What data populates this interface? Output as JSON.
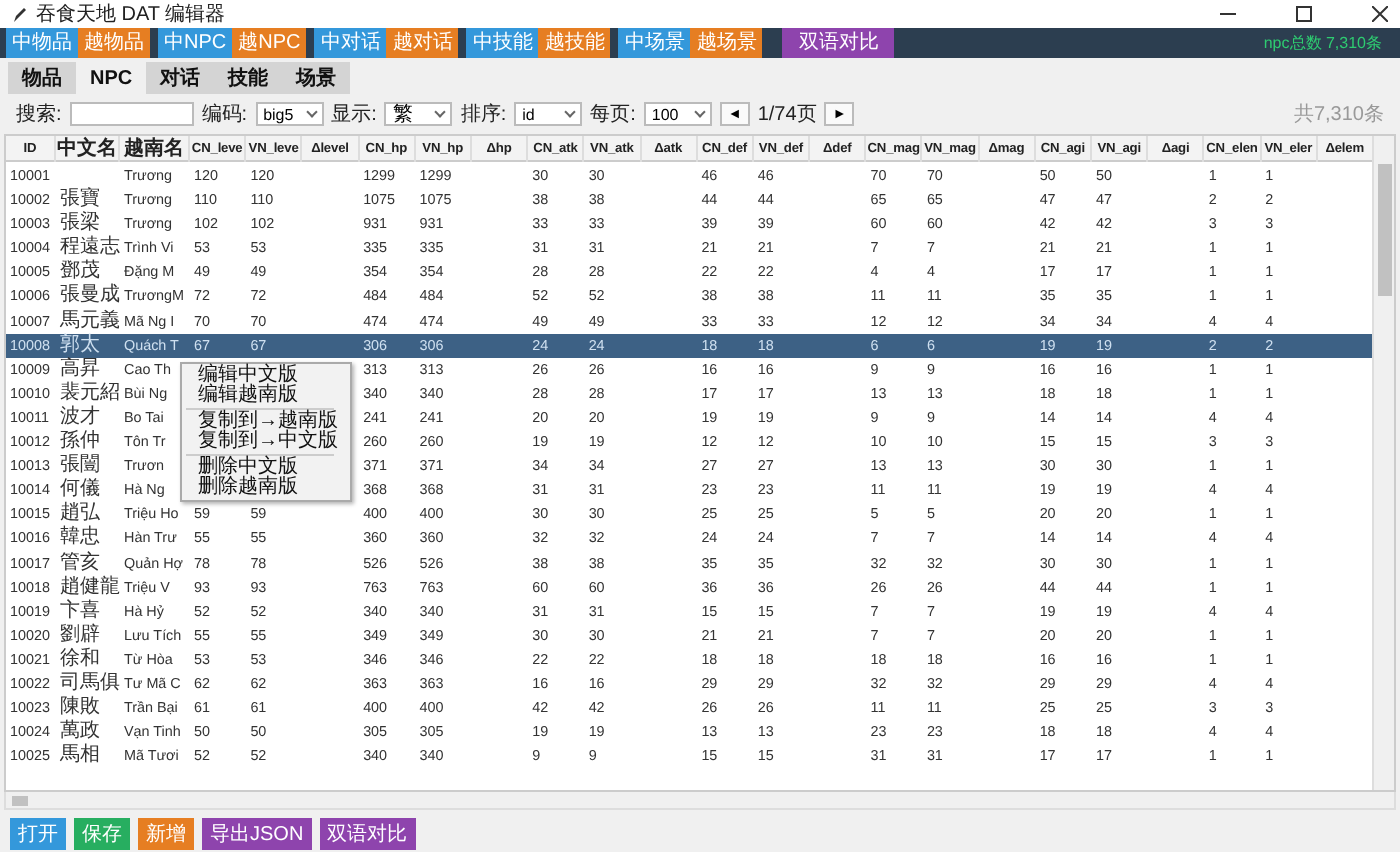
{
  "window": {
    "title": "吞食天地 DAT 编辑器"
  },
  "toolbar": {
    "buttons": [
      {
        "label": "中物品",
        "kind": "cn"
      },
      {
        "label": "越物品",
        "kind": "vn"
      },
      {
        "label": "中NPC",
        "kind": "cn"
      },
      {
        "label": "越NPC",
        "kind": "vn"
      },
      {
        "label": "中对话",
        "kind": "cn"
      },
      {
        "label": "越对话",
        "kind": "vn"
      },
      {
        "label": "中技能",
        "kind": "cn"
      },
      {
        "label": "越技能",
        "kind": "vn"
      },
      {
        "label": "中场景",
        "kind": "cn"
      },
      {
        "label": "越场景",
        "kind": "vn"
      },
      {
        "label": "双语对比",
        "kind": "compare"
      }
    ],
    "status": "npc总数 7,310条"
  },
  "tabs": [
    {
      "label": "物品",
      "selected": false
    },
    {
      "label": "NPC",
      "selected": true
    },
    {
      "label": "对话",
      "selected": false
    },
    {
      "label": "技能",
      "selected": false
    },
    {
      "label": "场景",
      "selected": false
    }
  ],
  "filters": {
    "search_label": "搜索:",
    "encoding_label": "编码:",
    "encoding": "big5",
    "display_label": "显示:",
    "display": "繁",
    "sort_label": "排序:",
    "sort": "id",
    "page_size_label": "每页:",
    "page_size": "100",
    "prev": "◄",
    "page": "1/74页",
    "next": "►",
    "total": "共7,310条"
  },
  "table": {
    "columns": [
      "ID",
      "中文名",
      "越南名",
      "CN_leve",
      "VN_leve",
      "Δlevel",
      "CN_hp",
      "VN_hp",
      "Δhp",
      "CN_atk",
      "VN_atk",
      "Δatk",
      "CN_def",
      "VN_def",
      "Δdef",
      "CN_mag",
      "VN_mag",
      "Δmag",
      "CN_agi",
      "VN_agi",
      "Δagi",
      "CN_elen",
      "VN_eler",
      "Δelem"
    ],
    "rows": [
      {
        "selected": false,
        "cells": [
          "10001",
          "",
          "Trương",
          "120",
          "120",
          "",
          "1299",
          "1299",
          "",
          "30",
          "30",
          "",
          "46",
          "46",
          "",
          "70",
          "70",
          "",
          "50",
          "50",
          "",
          "1",
          "1",
          ""
        ]
      },
      {
        "selected": false,
        "cells": [
          "10002",
          "張寶",
          "Trương",
          "110",
          "110",
          "",
          "1075",
          "1075",
          "",
          "38",
          "38",
          "",
          "44",
          "44",
          "",
          "65",
          "65",
          "",
          "47",
          "47",
          "",
          "2",
          "2",
          ""
        ]
      },
      {
        "selected": false,
        "cells": [
          "10003",
          "張梁",
          "Trương",
          "102",
          "102",
          "",
          "931",
          "931",
          "",
          "33",
          "33",
          "",
          "39",
          "39",
          "",
          "60",
          "60",
          "",
          "42",
          "42",
          "",
          "3",
          "3",
          ""
        ]
      },
      {
        "selected": false,
        "cells": [
          "10004",
          "程遠志",
          "Trình Vi",
          "53",
          "53",
          "",
          "335",
          "335",
          "",
          "31",
          "31",
          "",
          "21",
          "21",
          "",
          "7",
          "7",
          "",
          "21",
          "21",
          "",
          "1",
          "1",
          ""
        ]
      },
      {
        "selected": false,
        "cells": [
          "10005",
          "鄧茂",
          "Đặng M",
          "49",
          "49",
          "",
          "354",
          "354",
          "",
          "28",
          "28",
          "",
          "22",
          "22",
          "",
          "4",
          "4",
          "",
          "17",
          "17",
          "",
          "1",
          "1",
          ""
        ]
      },
      {
        "selected": false,
        "cells": [
          "10006",
          "張曼成",
          "TrươngM",
          "72",
          "72",
          "",
          "484",
          "484",
          "",
          "52",
          "52",
          "",
          "38",
          "38",
          "",
          "11",
          "11",
          "",
          "35",
          "35",
          "",
          "1",
          "1",
          ""
        ]
      },
      {
        "selected": false,
        "cells": [
          "10007",
          "馬元義",
          "Mã Ng I",
          "70",
          "70",
          "",
          "474",
          "474",
          "",
          "49",
          "49",
          "",
          "33",
          "33",
          "",
          "12",
          "12",
          "",
          "34",
          "34",
          "",
          "4",
          "4",
          ""
        ]
      },
      {
        "selected": true,
        "cells": [
          "10008",
          "郭太",
          "Quách T",
          "67",
          "67",
          "",
          "306",
          "306",
          "",
          "24",
          "24",
          "",
          "18",
          "18",
          "",
          "6",
          "6",
          "",
          "19",
          "19",
          "",
          "2",
          "2",
          ""
        ]
      },
      {
        "selected": false,
        "cells": [
          "10009",
          "高昇",
          "Cao Th",
          "",
          "",
          "",
          "313",
          "313",
          "",
          "26",
          "26",
          "",
          "16",
          "16",
          "",
          "9",
          "9",
          "",
          "16",
          "16",
          "",
          "1",
          "1",
          ""
        ]
      },
      {
        "selected": false,
        "cells": [
          "10010",
          "裴元紹",
          "Bùi Ng",
          "",
          "",
          "",
          "340",
          "340",
          "",
          "28",
          "28",
          "",
          "17",
          "17",
          "",
          "13",
          "13",
          "",
          "18",
          "18",
          "",
          "1",
          "1",
          ""
        ]
      },
      {
        "selected": false,
        "cells": [
          "10011",
          "波才",
          "Bo Tai",
          "",
          "",
          "",
          "241",
          "241",
          "",
          "20",
          "20",
          "",
          "19",
          "19",
          "",
          "9",
          "9",
          "",
          "14",
          "14",
          "",
          "4",
          "4",
          ""
        ]
      },
      {
        "selected": false,
        "cells": [
          "10012",
          "孫仲",
          "Tôn Tr",
          "",
          "",
          "",
          "260",
          "260",
          "",
          "19",
          "19",
          "",
          "12",
          "12",
          "",
          "10",
          "10",
          "",
          "15",
          "15",
          "",
          "3",
          "3",
          ""
        ]
      },
      {
        "selected": false,
        "cells": [
          "10013",
          "張闓",
          "Trươn",
          "",
          "",
          "",
          "371",
          "371",
          "",
          "34",
          "34",
          "",
          "27",
          "27",
          "",
          "13",
          "13",
          "",
          "30",
          "30",
          "",
          "1",
          "1",
          ""
        ]
      },
      {
        "selected": false,
        "cells": [
          "10014",
          "何儀",
          "Hà Ng",
          "",
          "",
          "",
          "368",
          "368",
          "",
          "31",
          "31",
          "",
          "23",
          "23",
          "",
          "11",
          "11",
          "",
          "19",
          "19",
          "",
          "4",
          "4",
          ""
        ]
      },
      {
        "selected": false,
        "cells": [
          "10015",
          "趙弘",
          "Triệu Ho",
          "59",
          "59",
          "",
          "400",
          "400",
          "",
          "30",
          "30",
          "",
          "25",
          "25",
          "",
          "5",
          "5",
          "",
          "20",
          "20",
          "",
          "1",
          "1",
          ""
        ]
      },
      {
        "selected": false,
        "cells": [
          "10016",
          "韓忠",
          "Hàn Trư",
          "55",
          "55",
          "",
          "360",
          "360",
          "",
          "32",
          "32",
          "",
          "24",
          "24",
          "",
          "7",
          "7",
          "",
          "14",
          "14",
          "",
          "4",
          "4",
          ""
        ]
      },
      {
        "selected": false,
        "cells": [
          "10017",
          "管亥",
          "Quản Hợ",
          "78",
          "78",
          "",
          "526",
          "526",
          "",
          "38",
          "38",
          "",
          "35",
          "35",
          "",
          "32",
          "32",
          "",
          "30",
          "30",
          "",
          "1",
          "1",
          ""
        ]
      },
      {
        "selected": false,
        "cells": [
          "10018",
          "趙健龍",
          "Triệu V",
          "93",
          "93",
          "",
          "763",
          "763",
          "",
          "60",
          "60",
          "",
          "36",
          "36",
          "",
          "26",
          "26",
          "",
          "44",
          "44",
          "",
          "1",
          "1",
          ""
        ]
      },
      {
        "selected": false,
        "cells": [
          "10019",
          "卞喜",
          "Hà Hỷ",
          "52",
          "52",
          "",
          "340",
          "340",
          "",
          "31",
          "31",
          "",
          "15",
          "15",
          "",
          "7",
          "7",
          "",
          "19",
          "19",
          "",
          "4",
          "4",
          ""
        ]
      },
      {
        "selected": false,
        "cells": [
          "10020",
          "劉辟",
          "Lưu Tích",
          "55",
          "55",
          "",
          "349",
          "349",
          "",
          "30",
          "30",
          "",
          "21",
          "21",
          "",
          "7",
          "7",
          "",
          "20",
          "20",
          "",
          "1",
          "1",
          ""
        ]
      },
      {
        "selected": false,
        "cells": [
          "10021",
          "徐和",
          "Từ Hòa",
          "53",
          "53",
          "",
          "346",
          "346",
          "",
          "22",
          "22",
          "",
          "18",
          "18",
          "",
          "18",
          "18",
          "",
          "16",
          "16",
          "",
          "1",
          "1",
          ""
        ]
      },
      {
        "selected": false,
        "cells": [
          "10022",
          "司馬俱",
          "Tư Mã C",
          "62",
          "62",
          "",
          "363",
          "363",
          "",
          "16",
          "16",
          "",
          "29",
          "29",
          "",
          "32",
          "32",
          "",
          "29",
          "29",
          "",
          "4",
          "4",
          ""
        ]
      },
      {
        "selected": false,
        "cells": [
          "10023",
          "陳敗",
          "Trần Bại",
          "61",
          "61",
          "",
          "400",
          "400",
          "",
          "42",
          "42",
          "",
          "26",
          "26",
          "",
          "11",
          "11",
          "",
          "25",
          "25",
          "",
          "3",
          "3",
          ""
        ]
      },
      {
        "selected": false,
        "cells": [
          "10024",
          "萬政",
          "Vạn Tinh",
          "50",
          "50",
          "",
          "305",
          "305",
          "",
          "19",
          "19",
          "",
          "13",
          "13",
          "",
          "23",
          "23",
          "",
          "18",
          "18",
          "",
          "4",
          "4",
          ""
        ]
      },
      {
        "selected": false,
        "cells": [
          "10025",
          "馬相",
          "Mã Tươi",
          "52",
          "52",
          "",
          "340",
          "340",
          "",
          "9",
          "9",
          "",
          "15",
          "15",
          "",
          "31",
          "31",
          "",
          "17",
          "17",
          "",
          "1",
          "1",
          ""
        ]
      }
    ]
  },
  "context_menu": {
    "groups": [
      [
        "编辑中文版",
        "编辑越南版"
      ],
      [
        "复制到→越南版",
        "复制到→中文版"
      ],
      [
        "删除中文版",
        "删除越南版"
      ]
    ]
  },
  "bottom_buttons": [
    {
      "label": "打开",
      "kind": "open"
    },
    {
      "label": "保存",
      "kind": "save"
    },
    {
      "label": "新增",
      "kind": "add"
    },
    {
      "label": "导出JSON",
      "kind": "export"
    },
    {
      "label": "双语对比",
      "kind": "compare"
    }
  ]
}
